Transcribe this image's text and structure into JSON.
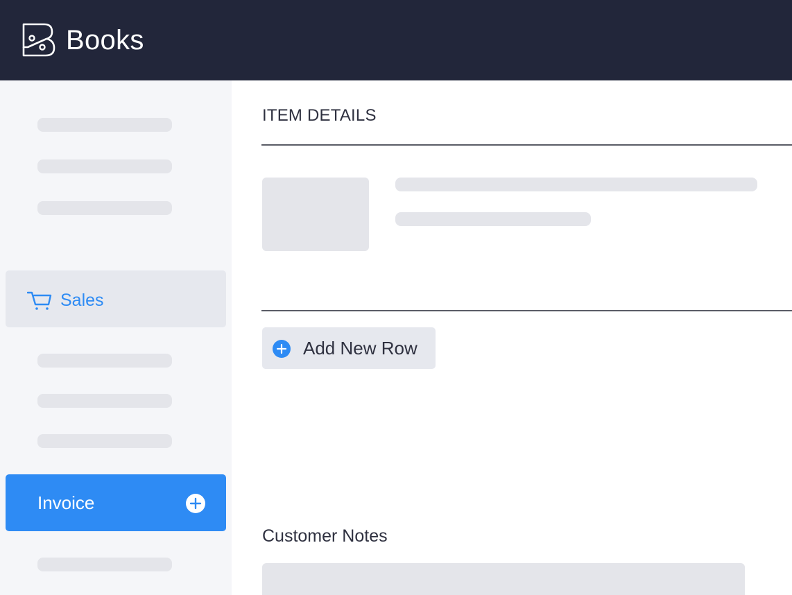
{
  "app": {
    "name": "Books",
    "brand_color": "#22263a",
    "accent_color": "#2e8bf4",
    "logo_icon": "books-logo-icon"
  },
  "sidebar": {
    "sales": {
      "label": "Sales",
      "icon": "cart-icon"
    },
    "invoice": {
      "label": "Invoice",
      "icon": "plus-circle-icon"
    }
  },
  "main": {
    "section_title": "ITEM DETAILS",
    "add_row": {
      "label": "Add New Row",
      "icon": "plus-circle-icon"
    },
    "notes_label": "Customer Notes"
  }
}
